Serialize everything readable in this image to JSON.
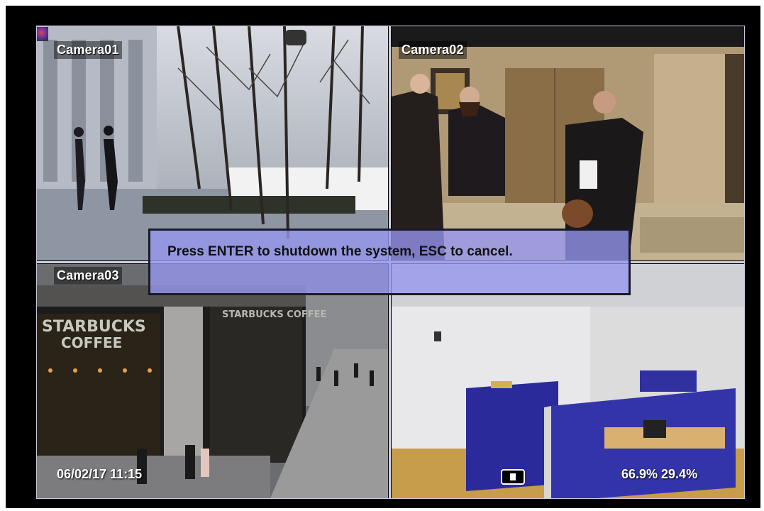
{
  "cameras": [
    {
      "label": "Camera01"
    },
    {
      "label": "Camera02"
    },
    {
      "label": "Camera03"
    }
  ],
  "dialog": {
    "message": "Press ENTER to shutdown the system, ESC to cancel."
  },
  "status": {
    "datetime": "06/02/17 11:15",
    "usage": "66.9% 29.4%"
  },
  "colors": {
    "background": "#000000",
    "dialog_bg": "#9696f0",
    "dialog_border": "#1a1a2a",
    "osd_text": "#ffffff"
  },
  "icons": [
    "record-icon",
    "status-icon"
  ]
}
